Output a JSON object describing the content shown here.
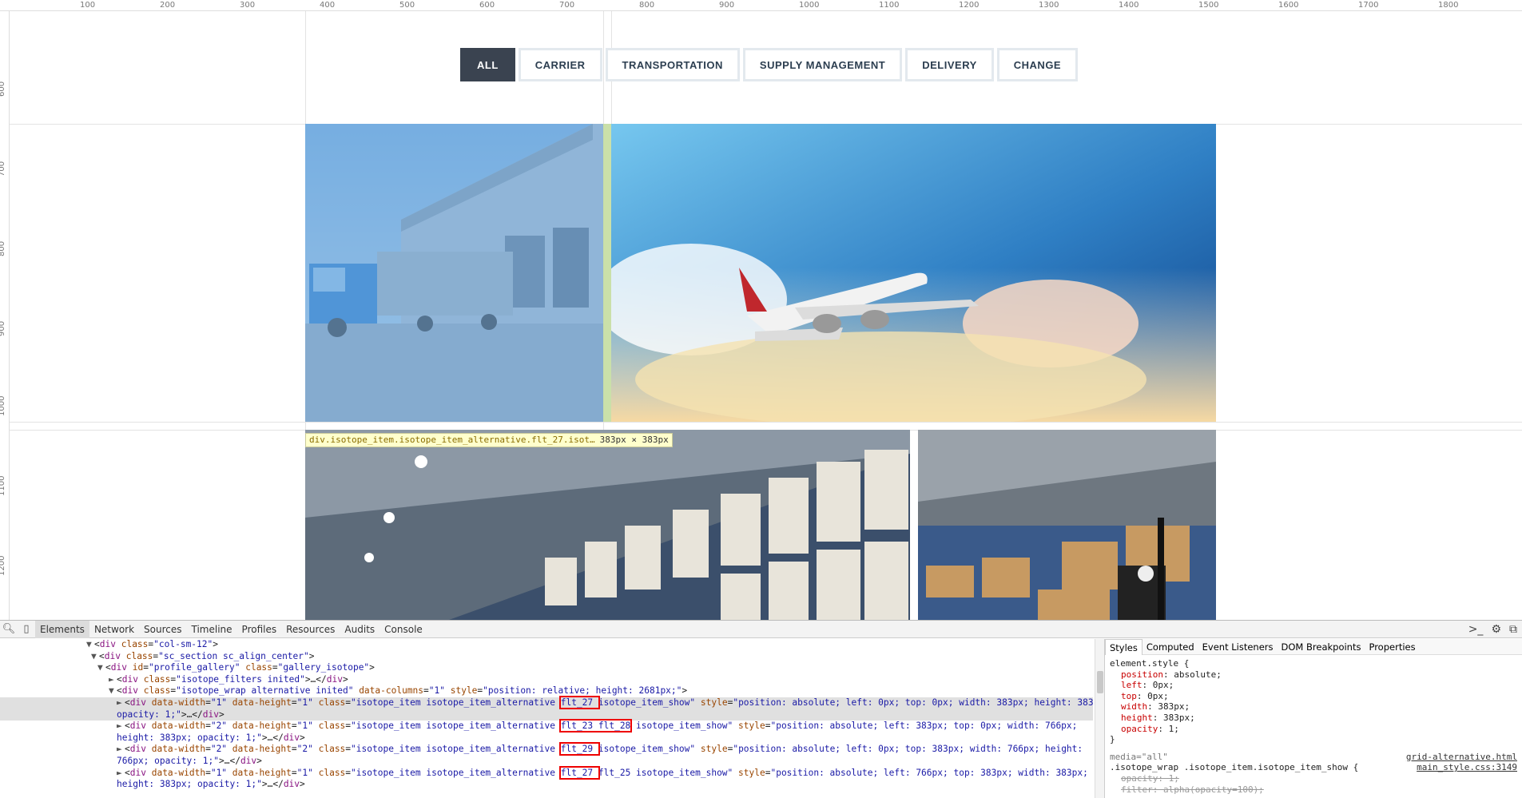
{
  "ruler": {
    "top_ticks": [
      "100",
      "200",
      "300",
      "400",
      "500",
      "600",
      "700",
      "800",
      "900",
      "1000",
      "1100",
      "1200",
      "1300",
      "1400",
      "1500",
      "1600",
      "1700",
      "1800"
    ],
    "left_ticks": [
      "600",
      "700",
      "800",
      "900",
      "1000",
      "1100",
      "1200"
    ]
  },
  "filters": [
    {
      "label": "ALL",
      "active": true
    },
    {
      "label": "CARRIER",
      "active": false
    },
    {
      "label": "TRANSPORTATION",
      "active": false
    },
    {
      "label": "SUPPLY MANAGEMENT",
      "active": false
    },
    {
      "label": "DELIVERY",
      "active": false
    },
    {
      "label": "CHANGE",
      "active": false
    }
  ],
  "tooltip": {
    "selector": "div.isotope_item.isotope_item_alternative.flt_27.isot…",
    "size": "383px × 383px"
  },
  "devtools": {
    "tabs": [
      "Elements",
      "Network",
      "Sources",
      "Timeline",
      "Profiles",
      "Resources",
      "Audits",
      "Console"
    ],
    "dom_lines": [
      {
        "indent": 9,
        "html": "▼ &lt;div <a>class</a>=<v>\"col-sm-12\"</v>&gt;"
      },
      {
        "indent": 11,
        "html": "▼ &lt;div <a>class</a>=<v>\"sc_section sc_align_center\"</v>&gt;"
      },
      {
        "indent": 12,
        "html": "▼ &lt;div <a>id</a>=<v>\"profile_gallery\"</v> <a>class</a>=<v>\"gallery_isotope\"</v>&gt;"
      },
      {
        "indent": 14,
        "html": "► &lt;div <a>class</a>=<v>\"isotope_filters inited\"</v>&gt;…&lt;/div&gt;"
      },
      {
        "indent": 14,
        "html": "▼ &lt;div <a>class</a>=<v>\"isotope_wrap alternative inited\"</v> <a>data-columns</a>=<v>\"1\"</v> <a>style</a>=<v>\"position: relative; height: 2681px;\"</v>&gt;"
      }
    ],
    "styles_tabs": [
      "Styles",
      "Computed",
      "Event Listeners",
      "DOM Breakpoints",
      "Properties"
    ],
    "element_style_header": "element.style {",
    "element_style": [
      {
        "name": "position",
        "value": "absolute;"
      },
      {
        "name": "left",
        "value": "0px;"
      },
      {
        "name": "top",
        "value": "0px;"
      },
      {
        "name": "width",
        "value": "383px;"
      },
      {
        "name": "height",
        "value": "383px;"
      },
      {
        "name": "opacity",
        "value": "1;"
      }
    ],
    "close_brace": "}",
    "media": "media=\"all\"",
    "rule_selector": ".isotope_wrap .isotope_item.isotope_item_show {",
    "file1": "grid-alternative.html",
    "file2": "main_style.css:3149",
    "struck_prop": "opacity: 1;",
    "struck_prop2": "filter: alpha(opacity=100);"
  }
}
